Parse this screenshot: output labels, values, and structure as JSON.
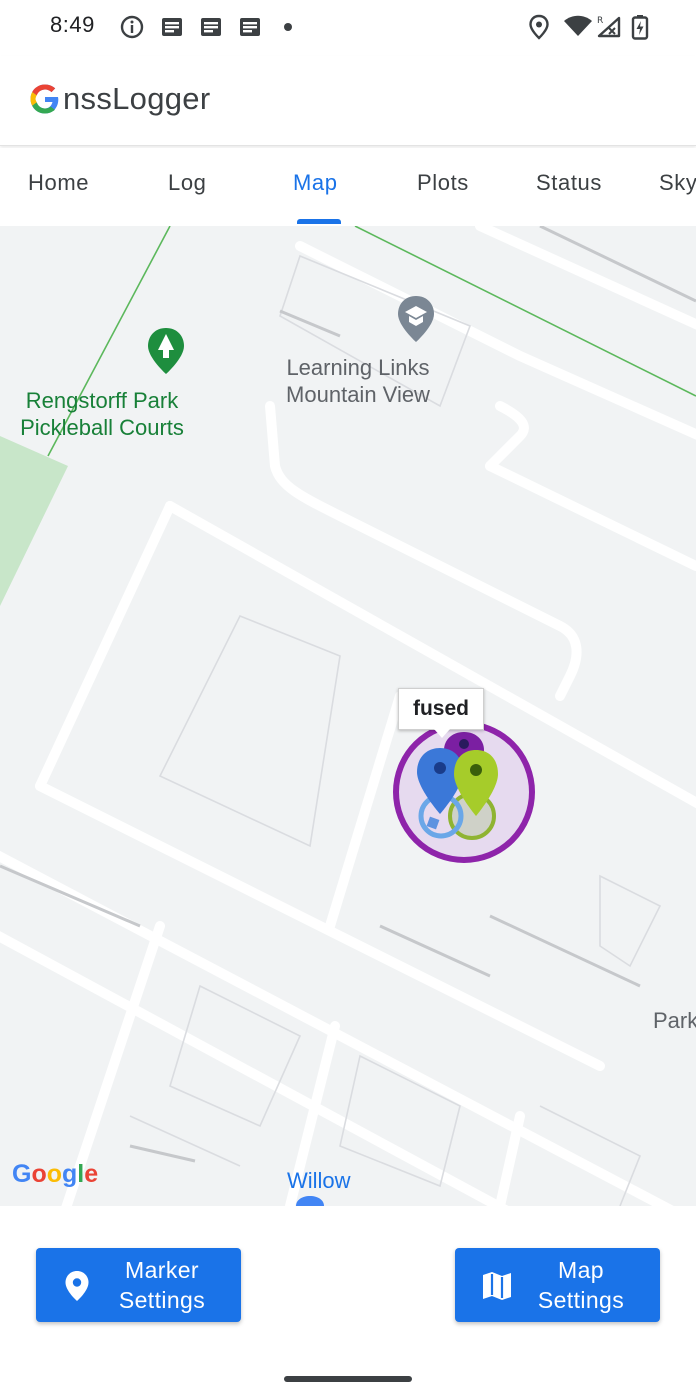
{
  "status_bar": {
    "time": "8:49",
    "icons": [
      "info-icon",
      "notification-icon",
      "notification-icon",
      "notification-icon",
      "dot-icon",
      "location-icon",
      "wifi-icon",
      "signal-icon",
      "battery-charging-icon"
    ]
  },
  "app": {
    "title_rest": "nssLogger",
    "brand_colors": [
      "#4285F4",
      "#EA4335",
      "#FBBC05",
      "#34A853"
    ]
  },
  "tabs": [
    {
      "label": "Home",
      "active": false
    },
    {
      "label": "Log",
      "active": false
    },
    {
      "label": "Map",
      "active": true
    },
    {
      "label": "Plots",
      "active": false
    },
    {
      "label": "Status",
      "active": false
    },
    {
      "label": "Sky",
      "active": false
    }
  ],
  "map": {
    "park_label_line1": "Rengstorff Park",
    "park_label_line2": "Pickleball Courts",
    "school_label_line1": "Learning Links",
    "school_label_line2": "Mountain View",
    "street_label_right": "Park",
    "street_label_bottom": "Willow",
    "marker_tag": "fused",
    "google_logo": [
      "G",
      "o",
      "o",
      "g",
      "l",
      "e"
    ],
    "colors": {
      "fused_circle": "#8e24aa",
      "gps_marker": "#4285f4",
      "network_marker": "#9acd32",
      "park_area": "#c8e6c9"
    }
  },
  "buttons": {
    "marker_line1": "Marker",
    "marker_line2": "Settings",
    "map_line1": "Map",
    "map_line2": "Settings",
    "color": "#1a73e8"
  }
}
